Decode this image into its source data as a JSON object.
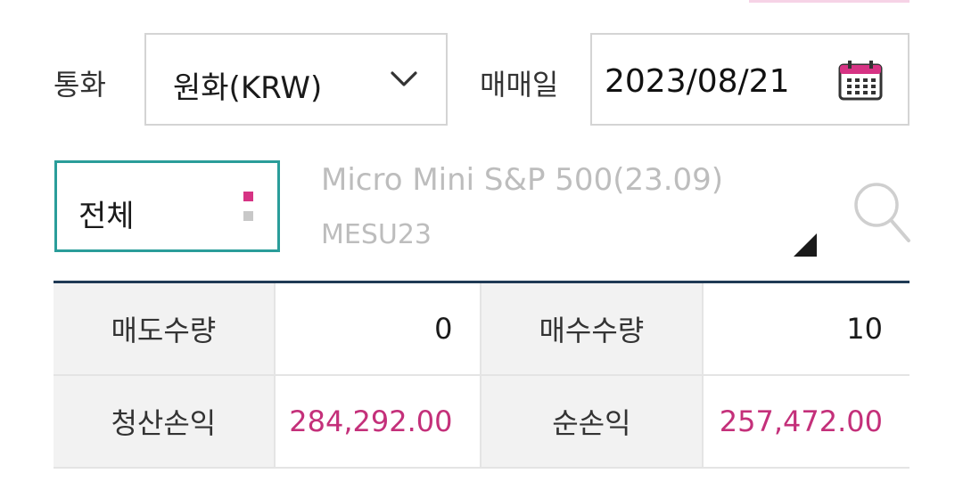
{
  "filters": {
    "currency_label": "통화",
    "currency_value": "원화(KRW)",
    "trade_date_label": "매매일",
    "trade_date_value": "2023/08/21",
    "category_value": "전체"
  },
  "symbol": {
    "name": "Micro Mini S&P 500(23.09)",
    "code": "MESU23"
  },
  "summary": {
    "rows": [
      {
        "label1": "매도수량",
        "value1": "0",
        "label2": "매수수량",
        "value2": "10"
      },
      {
        "label1": "청산손익",
        "value1": "284,292.00",
        "label2": "순손익",
        "value2": "257,472.00"
      }
    ]
  },
  "icons": {
    "dropdown": "chevron-down-icon",
    "calendar": "calendar-icon",
    "menu": "dots-menu-icon",
    "search": "search-icon",
    "corner": "corner-triangle-icon"
  },
  "colors": {
    "accent_teal": "#2a9d9a",
    "accent_pink": "#c4307a",
    "header_navy": "#1f3a55",
    "calendar_pink": "#d63384"
  }
}
